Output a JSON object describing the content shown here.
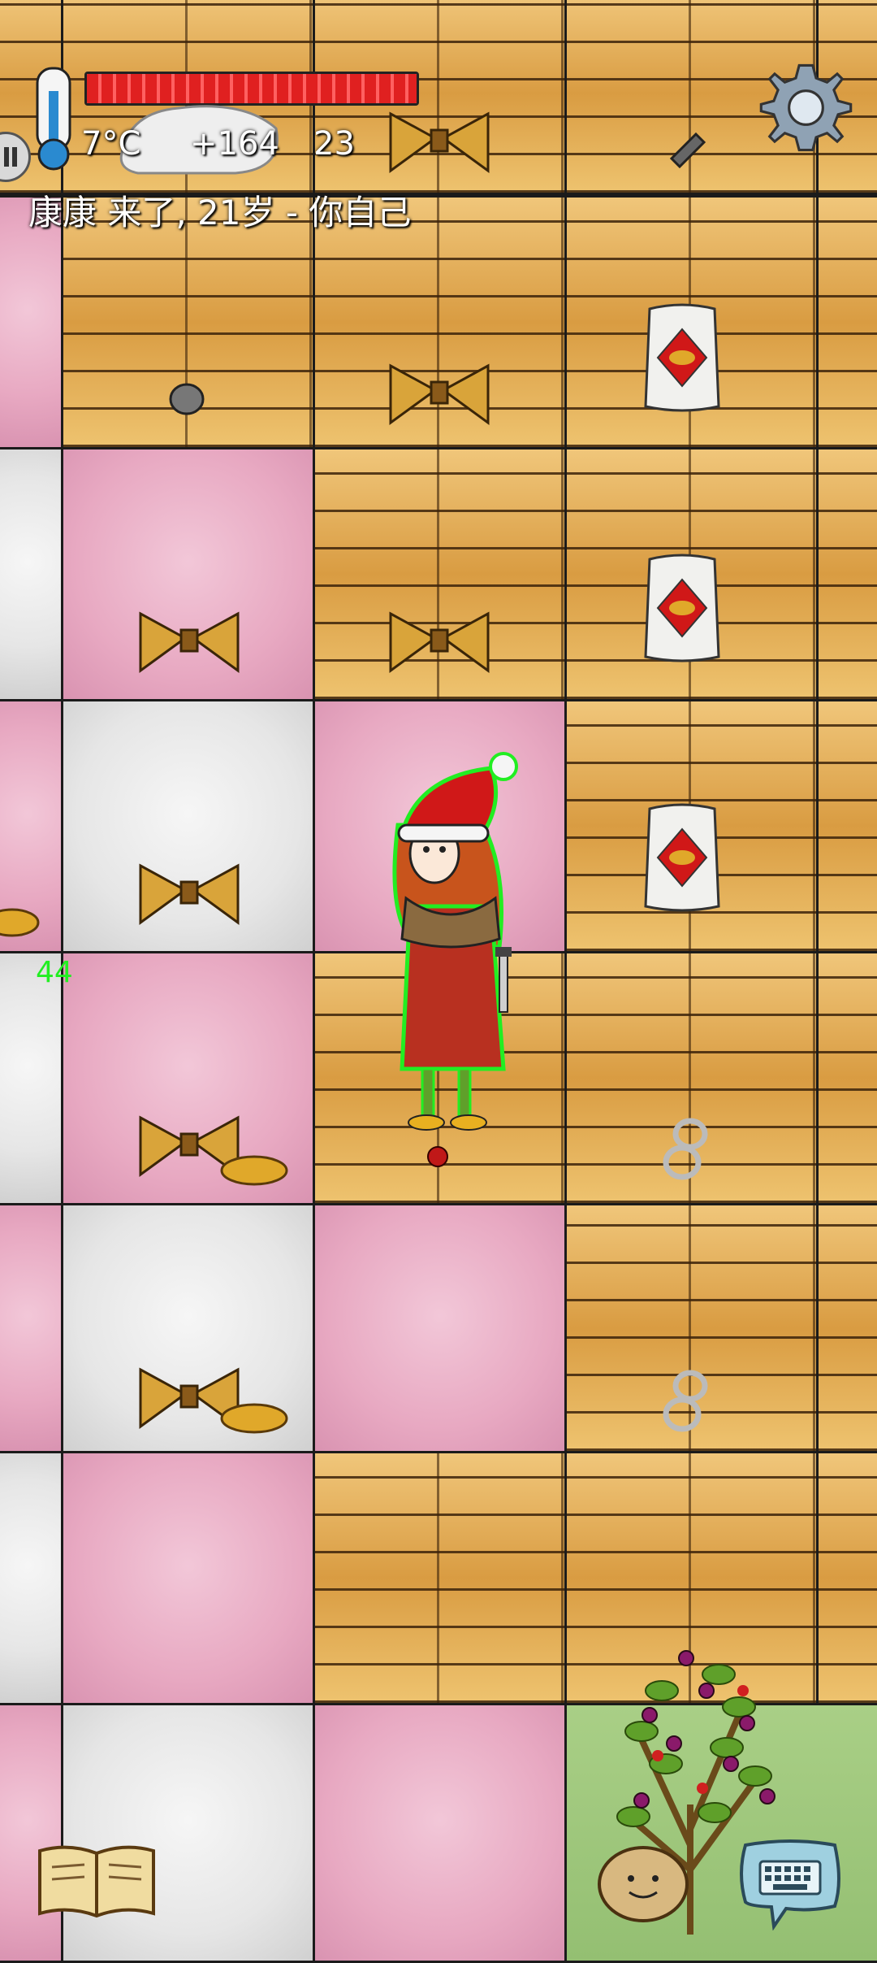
{
  "hud": {
    "temperature": "7°C",
    "yum_bonus": "+164",
    "food_count": "23",
    "health_fraction": 1.0,
    "player_status": "康康 来了, 21岁 - 你自己"
  },
  "world": {
    "hover_number": "44"
  },
  "icons": {
    "thermometer": "thermometer-icon",
    "settings": "gear-icon",
    "pause": "pause-icon",
    "tech_tree": "book-icon",
    "chat": "keyboard-chat-icon",
    "emote": "potato-face-icon"
  },
  "colors": {
    "health": "#e02020",
    "player_outline": "#22ee22"
  }
}
